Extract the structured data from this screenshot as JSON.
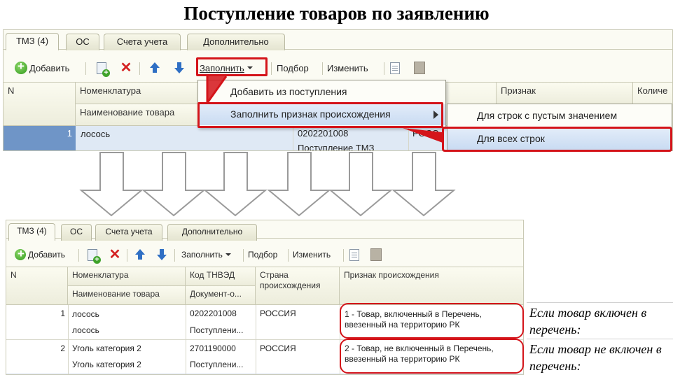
{
  "title": "Поступление товаров по заявлению",
  "tabs": [
    "ТМЗ (4)",
    "ОС",
    "Счета учета",
    "Дополнительно"
  ],
  "toolbar": {
    "add_label": "Добавить",
    "fill_label": "Заполнить",
    "select_label": "Подбор",
    "change_label": "Изменить"
  },
  "top_grid": {
    "col_n": "N",
    "col_nomen": "Номенклатура",
    "col_name": "Наименование товара",
    "col_sign": "Признак",
    "col_qty": "Количе",
    "row1": {
      "n": "1",
      "nomen": "лосось",
      "code": "0202201008",
      "country": "РОСС",
      "doc": "Поступление ТМЗ"
    }
  },
  "menu": {
    "item1": "Добавить из поступления",
    "item2": "Заполнить признак происхождения"
  },
  "submenu": {
    "item1": "Для строк с пустым значением",
    "item2": "Для всех строк"
  },
  "bottom_grid": {
    "col_n": "N",
    "col_nomen": "Номенклатура",
    "col_name": "Наименование товара",
    "col_code": "Код ТНВЭД",
    "col_doc": "Документ-о...",
    "col_country": "Страна происхождения",
    "col_sign": "Признак происхождения",
    "rows": [
      {
        "n": "1",
        "nomen": "лосось",
        "name": "лосось",
        "code": "0202201008",
        "doc": "Поступлени...",
        "country": "РОССИЯ",
        "sign": "1 - Товар, включенный в Перечень, ввезенный на территорию РК"
      },
      {
        "n": "2",
        "nomen": "Уголь категория 2",
        "name": "Уголь категория 2",
        "code": "2701190000",
        "doc": "Поступлени...",
        "country": "РОССИЯ",
        "sign": "2 - Товар, не включенный в Перечень, ввезенный на территорию РК"
      }
    ]
  },
  "notes": {
    "note1": "Если товар включен в перечень:",
    "note2": "Если товар не включен в перечень:"
  }
}
